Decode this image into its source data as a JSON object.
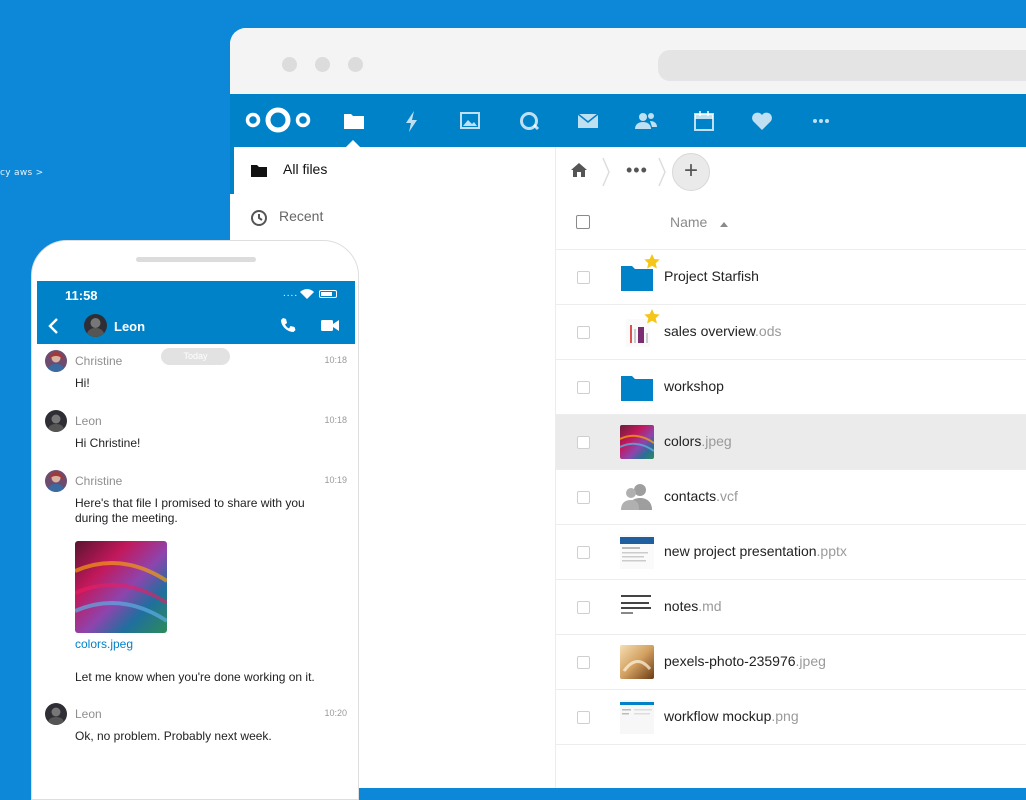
{
  "background_crumb": "cy aws >",
  "browser": {
    "nav_icons": [
      "files-icon",
      "activity-icon",
      "photos-icon",
      "talk-icon",
      "mail-icon",
      "contacts-icon",
      "calendar-icon",
      "favorites-icon",
      "more-apps-icon"
    ]
  },
  "sidebar": {
    "items": [
      {
        "label": "All files",
        "icon": "folder-icon",
        "active": true
      },
      {
        "label": "Recent",
        "icon": "clock-icon",
        "active": false
      }
    ]
  },
  "files": {
    "breadcrumb_more": "•••",
    "add_label": "+",
    "header_name": "Name",
    "rows": [
      {
        "base": "Project Starfish",
        "ext": "",
        "type": "folder",
        "starred": true
      },
      {
        "base": "sales overview",
        "ext": ".ods",
        "type": "spreadsheet",
        "starred": true
      },
      {
        "base": "workshop",
        "ext": "",
        "type": "folder",
        "starred": false
      },
      {
        "base": "colors",
        "ext": ".jpeg",
        "type": "image",
        "starred": false,
        "selected": true
      },
      {
        "base": "contacts",
        "ext": ".vcf",
        "type": "contacts",
        "starred": false
      },
      {
        "base": "new project presentation",
        "ext": ".pptx",
        "type": "presentation",
        "starred": false
      },
      {
        "base": "notes",
        "ext": ".md",
        "type": "text",
        "starred": false
      },
      {
        "base": "pexels-photo-235976",
        "ext": ".jpeg",
        "type": "image",
        "starred": false
      },
      {
        "base": "workflow mockup",
        "ext": ".png",
        "type": "image",
        "starred": false
      }
    ]
  },
  "phone": {
    "time": "11:58",
    "signal": "....",
    "contact": "Leon",
    "today": "Today",
    "messages": [
      {
        "author": "Christine",
        "time": "10:18",
        "text": "Hi!"
      },
      {
        "author": "Leon",
        "time": "10:18",
        "text": "Hi Christine!"
      },
      {
        "author": "Christine",
        "time": "10:19",
        "text": "Here's that file I promised to share with you during the meeting."
      },
      {
        "author": "Leon",
        "time": "10:20",
        "text": "Ok, no problem. Probably next week."
      }
    ],
    "attachment_name": "colors.jpeg",
    "followup": "Let me know when you're done working on it."
  },
  "colors": {
    "brand": "#0082c9",
    "background": "#0d88d8",
    "star": "#f5c518"
  }
}
